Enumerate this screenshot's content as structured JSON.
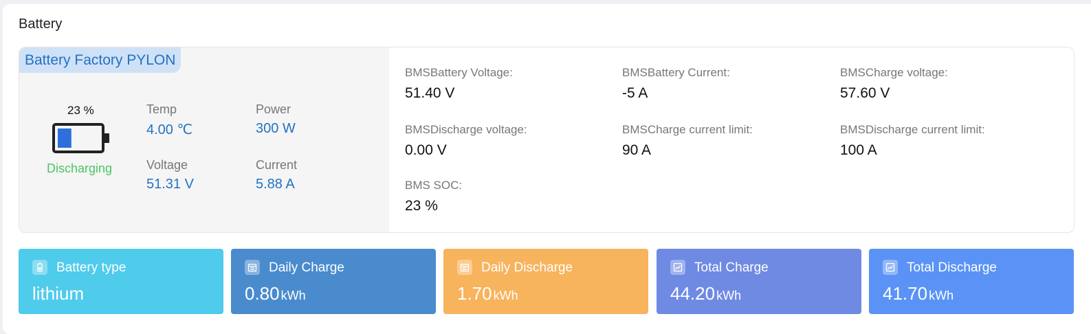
{
  "card": {
    "title": "Battery"
  },
  "battery": {
    "factory": "Battery Factory PYLON",
    "soc": "23 %",
    "soc_level": 0.23,
    "state": "Discharging",
    "metrics": {
      "temp": {
        "label": "Temp",
        "value": "4.00 ℃"
      },
      "power": {
        "label": "Power",
        "value": "300 W"
      },
      "voltage": {
        "label": "Voltage",
        "value": "51.31 V"
      },
      "current": {
        "label": "Current",
        "value": "5.88 A"
      }
    }
  },
  "bms": {
    "battery_voltage": {
      "label": "BMSBattery Voltage:",
      "value": "51.40 V"
    },
    "battery_current": {
      "label": "BMSBattery Current:",
      "value": "-5 A"
    },
    "charge_voltage": {
      "label": "BMSCharge voltage:",
      "value": "57.60 V"
    },
    "discharge_voltage": {
      "label": "BMSDischarge voltage:",
      "value": "0.00 V"
    },
    "charge_current_limit": {
      "label": "BMSCharge current limit:",
      "value": "90 A"
    },
    "discharge_current_limit": {
      "label": "BMSDischarge current limit:",
      "value": "100 A"
    },
    "soc": {
      "label": "BMS SOC:",
      "value": "23 %"
    }
  },
  "tiles": {
    "battery_type": {
      "label": "Battery type",
      "value": "lithium",
      "unit": "",
      "color": "#4fcbeb"
    },
    "daily_charge": {
      "label": "Daily Charge",
      "value": "0.80",
      "unit": "kWh",
      "color": "#4a8bce"
    },
    "daily_discharge": {
      "label": "Daily Discharge",
      "value": "1.70",
      "unit": "kWh",
      "color": "#f8b35d"
    },
    "total_charge": {
      "label": "Total Charge",
      "value": "44.20",
      "unit": "kWh",
      "color": "#6f8ae3"
    },
    "total_discharge": {
      "label": "Total Discharge",
      "value": "41.70",
      "unit": "kWh",
      "color": "#5a93f5"
    }
  },
  "colors": {
    "accent_blue": "#2372c4",
    "discharging_green": "#4cc463",
    "battery_fill": "#2e6fdc"
  },
  "icons": {
    "battery": "battery-icon",
    "tile_battery": "battery-small-icon",
    "tile_calendar": "calendar-icon",
    "tile_chart": "chart-icon"
  }
}
